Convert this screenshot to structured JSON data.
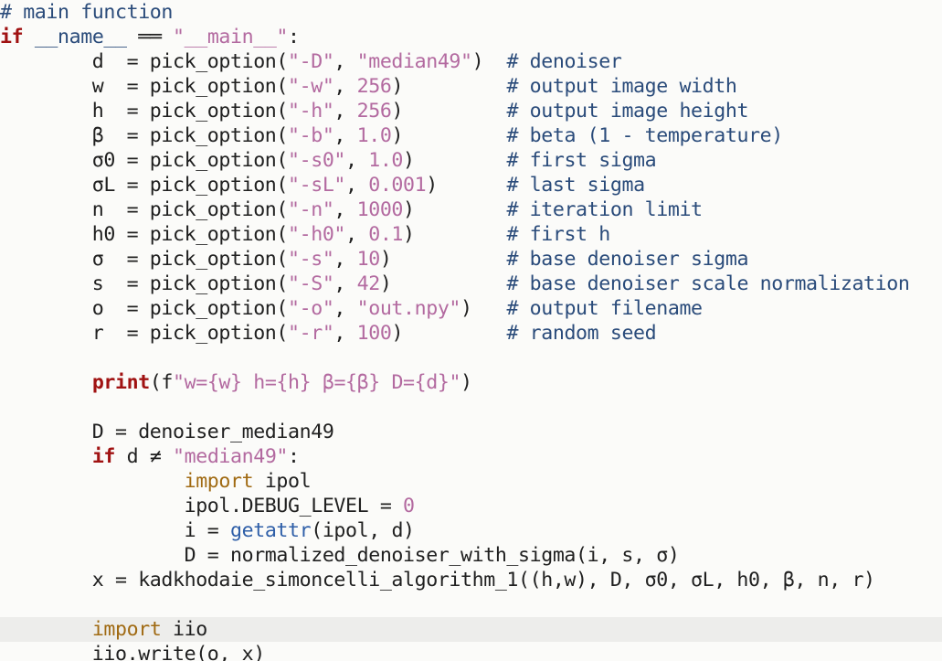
{
  "theme": {
    "background": "#fbfbf9",
    "current_line_background": "#ededeb",
    "colors": {
      "keyword": "#a01212",
      "import": "#a06a12",
      "string": "#b36aa0",
      "number": "#b36aa0",
      "comment": "#2a4b7a",
      "builtin_func": "#2f5fa8",
      "plain": "#202020"
    }
  },
  "editor": {
    "current_line_index": 25,
    "lines": [
      {
        "tokens": [
          {
            "t": "comment",
            "v": "# main function"
          }
        ]
      },
      {
        "tokens": [
          {
            "t": "kw-bold",
            "v": "if"
          },
          {
            "t": "plain",
            "v": " "
          },
          {
            "t": "dunder",
            "v": "__name__"
          },
          {
            "t": "plain",
            "v": " ══ "
          },
          {
            "t": "string",
            "v": "\"__main__\""
          },
          {
            "t": "plain",
            "v": ":"
          }
        ]
      },
      {
        "tokens": [
          {
            "t": "plain",
            "v": "        d  = pick_option("
          },
          {
            "t": "string",
            "v": "\"-D\""
          },
          {
            "t": "plain",
            "v": ", "
          },
          {
            "t": "string",
            "v": "\"median49\""
          },
          {
            "t": "plain",
            "v": ")  "
          },
          {
            "t": "comment",
            "v": "# denoiser"
          }
        ]
      },
      {
        "tokens": [
          {
            "t": "plain",
            "v": "        w  = pick_option("
          },
          {
            "t": "string",
            "v": "\"-w\""
          },
          {
            "t": "plain",
            "v": ", "
          },
          {
            "t": "number",
            "v": "256"
          },
          {
            "t": "plain",
            "v": ")         "
          },
          {
            "t": "comment",
            "v": "# output image width"
          }
        ]
      },
      {
        "tokens": [
          {
            "t": "plain",
            "v": "        h  = pick_option("
          },
          {
            "t": "string",
            "v": "\"-h\""
          },
          {
            "t": "plain",
            "v": ", "
          },
          {
            "t": "number",
            "v": "256"
          },
          {
            "t": "plain",
            "v": ")         "
          },
          {
            "t": "comment",
            "v": "# output image height"
          }
        ]
      },
      {
        "tokens": [
          {
            "t": "plain",
            "v": "        β  = pick_option("
          },
          {
            "t": "string",
            "v": "\"-b\""
          },
          {
            "t": "plain",
            "v": ", "
          },
          {
            "t": "number",
            "v": "1.0"
          },
          {
            "t": "plain",
            "v": ")         "
          },
          {
            "t": "comment",
            "v": "# beta (1 - temperature)"
          }
        ]
      },
      {
        "tokens": [
          {
            "t": "plain",
            "v": "        σ0 = pick_option("
          },
          {
            "t": "string",
            "v": "\"-s0\""
          },
          {
            "t": "plain",
            "v": ", "
          },
          {
            "t": "number",
            "v": "1.0"
          },
          {
            "t": "plain",
            "v": ")        "
          },
          {
            "t": "comment",
            "v": "# first sigma"
          }
        ]
      },
      {
        "tokens": [
          {
            "t": "plain",
            "v": "        σL = pick_option("
          },
          {
            "t": "string",
            "v": "\"-sL\""
          },
          {
            "t": "plain",
            "v": ", "
          },
          {
            "t": "number",
            "v": "0.001"
          },
          {
            "t": "plain",
            "v": ")      "
          },
          {
            "t": "comment",
            "v": "# last sigma"
          }
        ]
      },
      {
        "tokens": [
          {
            "t": "plain",
            "v": "        n  = pick_option("
          },
          {
            "t": "string",
            "v": "\"-n\""
          },
          {
            "t": "plain",
            "v": ", "
          },
          {
            "t": "number",
            "v": "1000"
          },
          {
            "t": "plain",
            "v": ")        "
          },
          {
            "t": "comment",
            "v": "# iteration limit"
          }
        ]
      },
      {
        "tokens": [
          {
            "t": "plain",
            "v": "        h0 = pick_option("
          },
          {
            "t": "string",
            "v": "\"-h0\""
          },
          {
            "t": "plain",
            "v": ", "
          },
          {
            "t": "number",
            "v": "0.1"
          },
          {
            "t": "plain",
            "v": ")        "
          },
          {
            "t": "comment",
            "v": "# first h"
          }
        ]
      },
      {
        "tokens": [
          {
            "t": "plain",
            "v": "        σ  = pick_option("
          },
          {
            "t": "string",
            "v": "\"-s\""
          },
          {
            "t": "plain",
            "v": ", "
          },
          {
            "t": "number",
            "v": "10"
          },
          {
            "t": "plain",
            "v": ")          "
          },
          {
            "t": "comment",
            "v": "# base denoiser sigma"
          }
        ]
      },
      {
        "tokens": [
          {
            "t": "plain",
            "v": "        s  = pick_option("
          },
          {
            "t": "string",
            "v": "\"-S\""
          },
          {
            "t": "plain",
            "v": ", "
          },
          {
            "t": "number",
            "v": "42"
          },
          {
            "t": "plain",
            "v": ")          "
          },
          {
            "t": "comment",
            "v": "# base denoiser scale normalization"
          }
        ]
      },
      {
        "tokens": [
          {
            "t": "plain",
            "v": "        o  = pick_option("
          },
          {
            "t": "string",
            "v": "\"-o\""
          },
          {
            "t": "plain",
            "v": ", "
          },
          {
            "t": "string",
            "v": "\"out.npy\""
          },
          {
            "t": "plain",
            "v": ")   "
          },
          {
            "t": "comment",
            "v": "# output filename"
          }
        ]
      },
      {
        "tokens": [
          {
            "t": "plain",
            "v": "        r  = pick_option("
          },
          {
            "t": "string",
            "v": "\"-r\""
          },
          {
            "t": "plain",
            "v": ", "
          },
          {
            "t": "number",
            "v": "100"
          },
          {
            "t": "plain",
            "v": ")         "
          },
          {
            "t": "comment",
            "v": "# random seed"
          }
        ]
      },
      {
        "tokens": [
          {
            "t": "plain",
            "v": ""
          }
        ]
      },
      {
        "tokens": [
          {
            "t": "plain",
            "v": "        "
          },
          {
            "t": "kw-bold",
            "v": "print"
          },
          {
            "t": "plain",
            "v": "(f"
          },
          {
            "t": "string",
            "v": "\"w={w} h={h} β={β} D={d}\""
          },
          {
            "t": "plain",
            "v": ")"
          }
        ]
      },
      {
        "tokens": [
          {
            "t": "plain",
            "v": ""
          }
        ]
      },
      {
        "tokens": [
          {
            "t": "plain",
            "v": "        D = denoiser_median49"
          }
        ]
      },
      {
        "tokens": [
          {
            "t": "plain",
            "v": "        "
          },
          {
            "t": "kw-bold",
            "v": "if"
          },
          {
            "t": "plain",
            "v": " d ≠ "
          },
          {
            "t": "string",
            "v": "\"median49\""
          },
          {
            "t": "plain",
            "v": ":"
          }
        ]
      },
      {
        "tokens": [
          {
            "t": "plain",
            "v": "                "
          },
          {
            "t": "kw-import",
            "v": "import"
          },
          {
            "t": "plain",
            "v": " ipol"
          }
        ]
      },
      {
        "tokens": [
          {
            "t": "plain",
            "v": "                ipol.DEBUG_LEVEL = "
          },
          {
            "t": "number",
            "v": "0"
          }
        ]
      },
      {
        "tokens": [
          {
            "t": "plain",
            "v": "                i = "
          },
          {
            "t": "builtin-func",
            "v": "getattr"
          },
          {
            "t": "plain",
            "v": "(ipol, d)"
          }
        ]
      },
      {
        "tokens": [
          {
            "t": "plain",
            "v": "                D = normalized_denoiser_with_sigma(i, s, σ)"
          }
        ]
      },
      {
        "tokens": [
          {
            "t": "plain",
            "v": "        x = kadkhodaie_simoncelli_algorithm_1((h,w), D, σ0, σL, h0, β, n, r)"
          }
        ]
      },
      {
        "tokens": [
          {
            "t": "plain",
            "v": ""
          }
        ]
      },
      {
        "tokens": [
          {
            "t": "plain",
            "v": "        "
          },
          {
            "t": "kw-import",
            "v": "import"
          },
          {
            "t": "plain",
            "v": " iio"
          }
        ]
      },
      {
        "tokens": [
          {
            "t": "plain",
            "v": "        iio.write(o, x)"
          }
        ]
      }
    ]
  }
}
